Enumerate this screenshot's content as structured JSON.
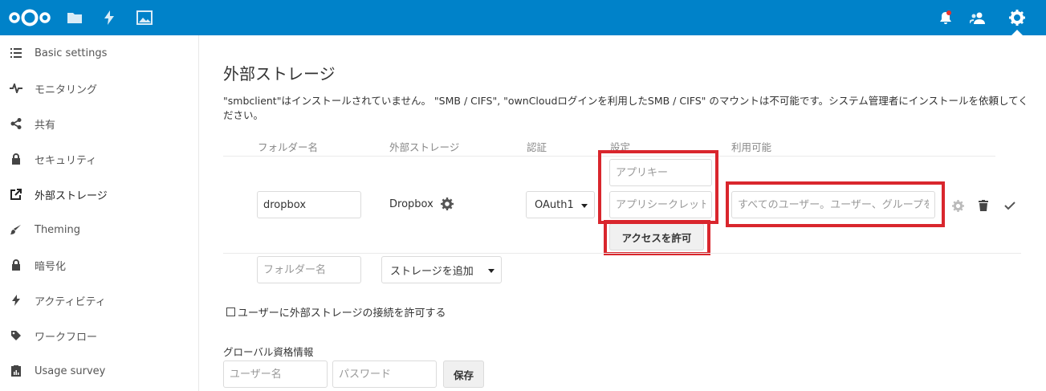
{
  "sidebar": {
    "items": [
      {
        "label": "Basic settings"
      },
      {
        "label": "モニタリング"
      },
      {
        "label": "共有"
      },
      {
        "label": "セキュリティ"
      },
      {
        "label": "外部ストレージ"
      },
      {
        "label": "Theming"
      },
      {
        "label": "暗号化"
      },
      {
        "label": "アクティビティ"
      },
      {
        "label": "ワークフロー"
      },
      {
        "label": "Usage survey"
      }
    ]
  },
  "main": {
    "title": "外部ストレージ",
    "warning": "\"smbclient\"はインストールされていません。 \"SMB / CIFS\", \"ownCloudログインを利用したSMB / CIFS\" のマウントは不可能です。システム管理者にインストールを依頼してください。",
    "table": {
      "headers": [
        "フォルダー名",
        "外部ストレージ",
        "認証",
        "設定",
        "利用可能"
      ],
      "row": {
        "folder_value": "dropbox",
        "storage_label": "Dropbox",
        "auth_value": "OAuth1",
        "app_key_placeholder": "アプリキー",
        "app_secret_placeholder": "アプリシークレット",
        "grant_access_label": "アクセスを許可",
        "available_placeholder": "すべてのユーザー。ユーザー、グループを"
      },
      "new_row": {
        "folder_placeholder": "フォルダー名",
        "add_storage_label": "ストレージを追加"
      }
    },
    "allow_user_mount_label": "ユーザーに外部ストレージの接続を許可する",
    "global_credentials": {
      "title": "グローバル資格情報",
      "username_placeholder": "ユーザー名",
      "password_placeholder": "パスワード",
      "save_label": "保存"
    }
  },
  "colors": {
    "header": "#0082c9",
    "highlight": "#d9262d"
  }
}
